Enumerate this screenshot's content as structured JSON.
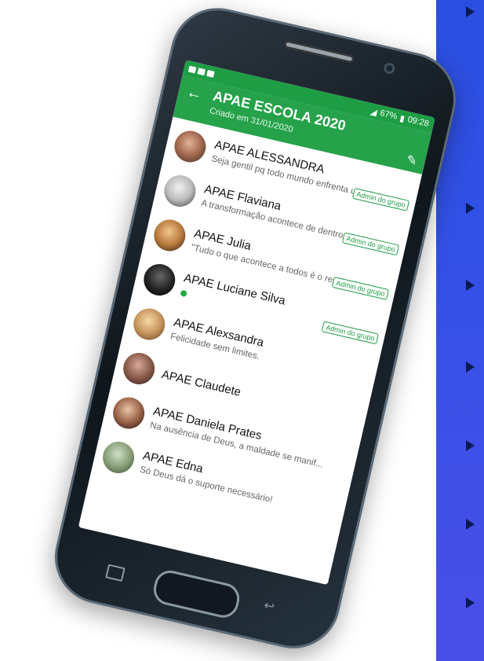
{
  "colors": {
    "header_green": "#25a24a",
    "status_green": "#1e9d45",
    "side_panel_blue": "#2a4fe0"
  },
  "status_bar": {
    "indicators": "■ ▶ ■ …",
    "signal": "№ ◢ ◢",
    "battery": "67%",
    "time": "09:28"
  },
  "header": {
    "back_icon": "arrow-left-icon",
    "title": "APAE ESCOLA 2020",
    "subtitle": "Criado em 31/01/2020",
    "edit_icon": "pencil-icon"
  },
  "members": [
    {
      "name": "APAE ALESSANDRA",
      "status": "Seja gentil pq todo mundo enfrenta uma b...",
      "badge": "Admin do grupo"
    },
    {
      "name": "APAE Flaviana",
      "status": "A transformação acontece de dentro pra f...",
      "badge": "Admin do grupo"
    },
    {
      "name": "APAE Julia",
      "status": "\"Tudo o que acontece a todos é o resultad...",
      "badge": "Admin do grupo"
    },
    {
      "name": "APAE Luciane Silva",
      "status": "",
      "badge": "Admin do grupo"
    },
    {
      "name": "APAE Alexsandra",
      "status": "Felicidade sem limites.",
      "badge": ""
    },
    {
      "name": "APAE Claudete",
      "status": "",
      "badge": ""
    },
    {
      "name": "APAE Daniela Prates",
      "status": "Na ausência de Deus, a maldade se manif...",
      "badge": ""
    },
    {
      "name": "APAE Edna",
      "status": "Só Deus dá o suporte necessário!",
      "badge": ""
    }
  ]
}
